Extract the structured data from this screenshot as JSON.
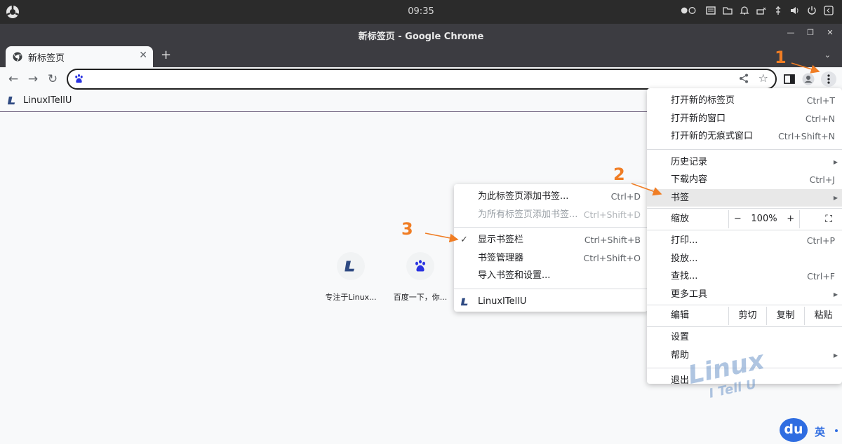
{
  "system_bar": {
    "time": "09:35"
  },
  "window": {
    "title": "新标签页 - Google Chrome"
  },
  "tabs": [
    {
      "title": "新标签页"
    }
  ],
  "omnibox": {
    "value": "",
    "placeholder": ""
  },
  "bookmarks_bar": {
    "items": [
      {
        "label": "LinuxITellU"
      }
    ]
  },
  "shortcuts": [
    {
      "label": "专注于Linux..."
    },
    {
      "label": "百度一下，你..."
    }
  ],
  "main_menu": {
    "group1": [
      {
        "label": "打开新的标签页",
        "shortcut": "Ctrl+T"
      },
      {
        "label": "打开新的窗口",
        "shortcut": "Ctrl+N"
      },
      {
        "label": "打开新的无痕式窗口",
        "shortcut": "Ctrl+Shift+N"
      }
    ],
    "history": "历史记录",
    "downloads": {
      "label": "下载内容",
      "shortcut": "Ctrl+J"
    },
    "bookmarks": "书签",
    "zoom": {
      "label": "缩放",
      "minus": "−",
      "value": "100%",
      "plus": "+"
    },
    "print": {
      "label": "打印...",
      "shortcut": "Ctrl+P"
    },
    "cast": "投放...",
    "find": {
      "label": "查找...",
      "shortcut": "Ctrl+F"
    },
    "more_tools": "更多工具",
    "edit": {
      "label": "编辑",
      "cut": "剪切",
      "copy": "复制",
      "paste": "粘贴"
    },
    "settings": "设置",
    "help": "帮助",
    "exit": "退出"
  },
  "bookmark_submenu": {
    "add_bookmark": {
      "label": "为此标签页添加书签...",
      "shortcut": "Ctrl+D"
    },
    "add_all": {
      "label": "为所有标签页添加书签...",
      "shortcut": "Ctrl+Shift+D"
    },
    "show_bar": {
      "label": "显示书签栏",
      "shortcut": "Ctrl+Shift+B",
      "checked": true
    },
    "manager": {
      "label": "书签管理器",
      "shortcut": "Ctrl+Shift+O"
    },
    "import": {
      "label": "导入书签和设置..."
    },
    "bookmark_item": {
      "label": "LinuxITellU"
    }
  },
  "annotations": [
    "1",
    "2",
    "3"
  ],
  "watermark": {
    "line1": "Linux",
    "line2": "I Tell U"
  },
  "ime": {
    "badge": "du",
    "mode": "英"
  },
  "colors": {
    "annotation": "#f07d24",
    "accent": "#2f6de1"
  }
}
